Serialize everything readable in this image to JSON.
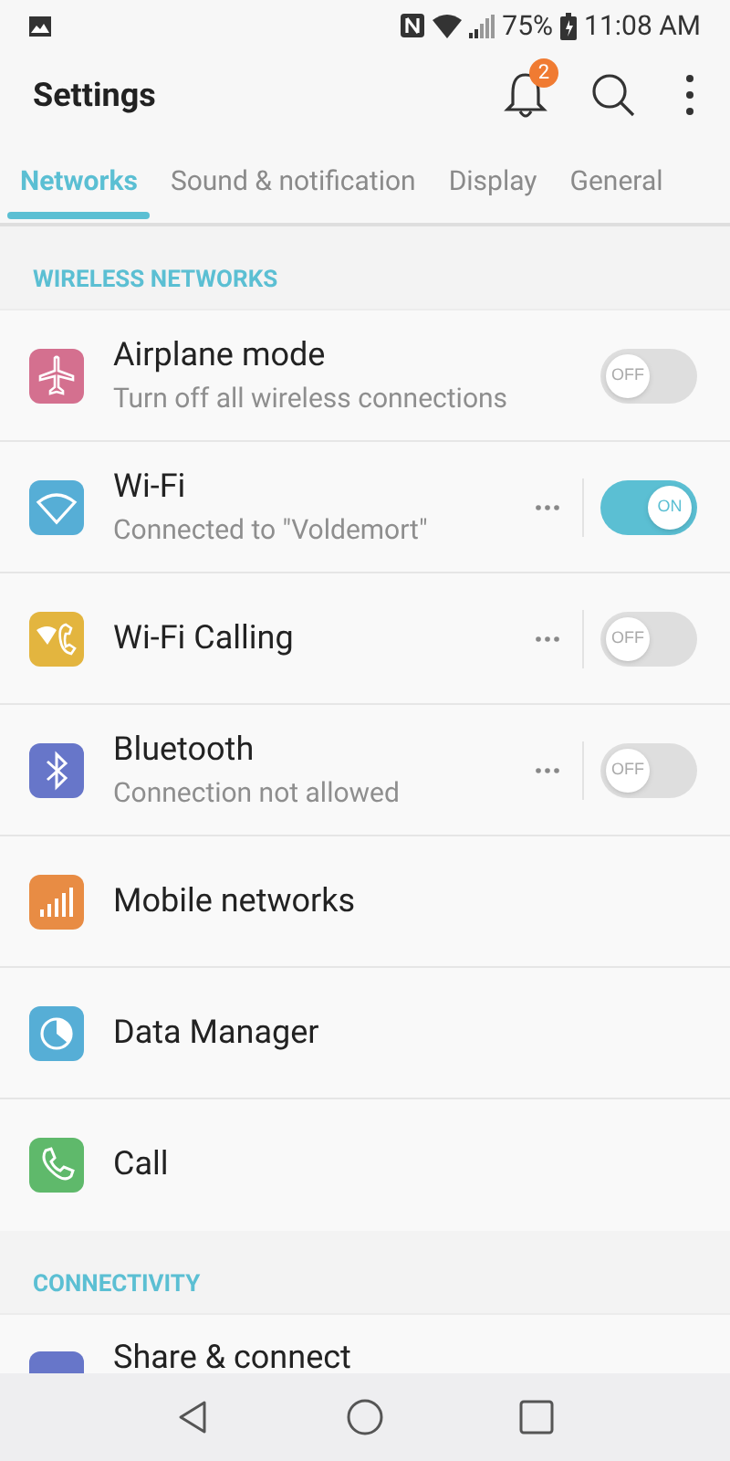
{
  "status_bar": {
    "battery": "75%",
    "time": "11:08 AM"
  },
  "app_bar": {
    "title": "Settings",
    "notification_count": "2"
  },
  "tabs": [
    {
      "label": "Networks",
      "selected": true
    },
    {
      "label": "Sound & notification",
      "selected": false
    },
    {
      "label": "Display",
      "selected": false
    },
    {
      "label": "General",
      "selected": false
    }
  ],
  "sections": [
    {
      "header": "WIRELESS NETWORKS",
      "items": [
        {
          "kind": "toggle",
          "title": "Airplane mode",
          "subtitle": "Turn off all wireless connections",
          "color": "#d4708f",
          "on": false,
          "switch_label": "OFF"
        },
        {
          "kind": "toggle",
          "title": "Wi-Fi",
          "subtitle": "Connected to \"Voldemort\"",
          "color": "#56aed6",
          "on": true,
          "more": true,
          "switch_label": "ON"
        },
        {
          "kind": "toggle",
          "title": "Wi-Fi Calling",
          "color": "#e3b53f",
          "on": false,
          "more": true,
          "switch_label": "OFF"
        },
        {
          "kind": "toggle",
          "title": "Bluetooth",
          "subtitle": "Connection not allowed",
          "color": "#6776c9",
          "on": false,
          "more": true,
          "switch_label": "OFF"
        },
        {
          "kind": "link",
          "title": "Mobile networks",
          "color": "#e88c44"
        },
        {
          "kind": "link",
          "title": "Data Manager",
          "color": "#56aed6"
        },
        {
          "kind": "link",
          "title": "Call",
          "color": "#5fb96b"
        }
      ]
    },
    {
      "header": "CONNECTIVITY",
      "items": [
        {
          "kind": "link",
          "title": "Share & connect",
          "color": "#6776c9"
        }
      ]
    }
  ]
}
